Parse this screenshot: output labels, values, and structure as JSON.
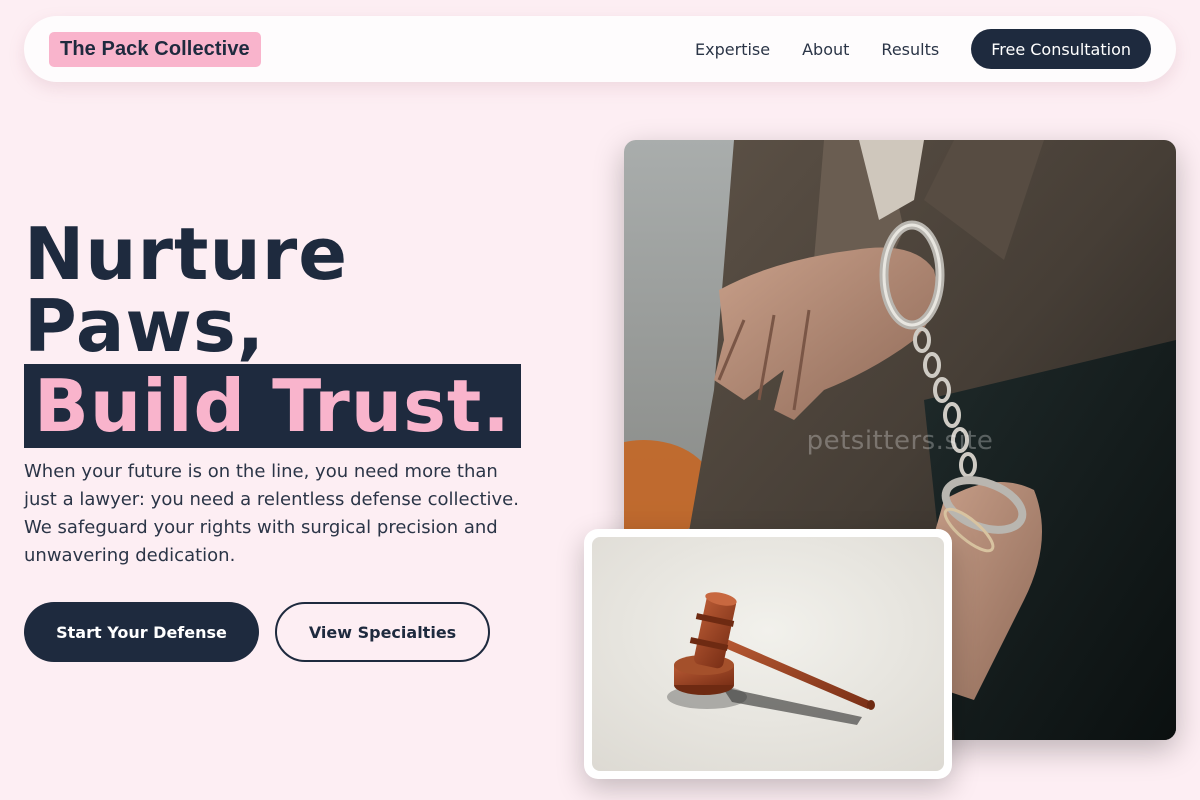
{
  "nav": {
    "brand": "The Pack Collective",
    "links": [
      "Expertise",
      "About",
      "Results"
    ],
    "cta_label": "Free Consultation"
  },
  "hero": {
    "headline_line1": "Nurture",
    "headline_line2": "Paws,",
    "headline_highlight": "Build Trust.",
    "description": "When your future is on the line, you need more than just a lawyer: you need a relentless defense collective. We safeguard your rights with surgical precision and unwavering dedication.",
    "primary_button": "Start Your Defense",
    "secondary_button": "View Specialties"
  },
  "images": {
    "main_watermark": "petsitters.site",
    "main_subject": "handcuffed-hands-photo",
    "inset_subject": "judge-gavel-photo"
  },
  "colors": {
    "background": "#fdeef3",
    "navy": "#1e2a3e",
    "pink": "#f9b4cc"
  }
}
